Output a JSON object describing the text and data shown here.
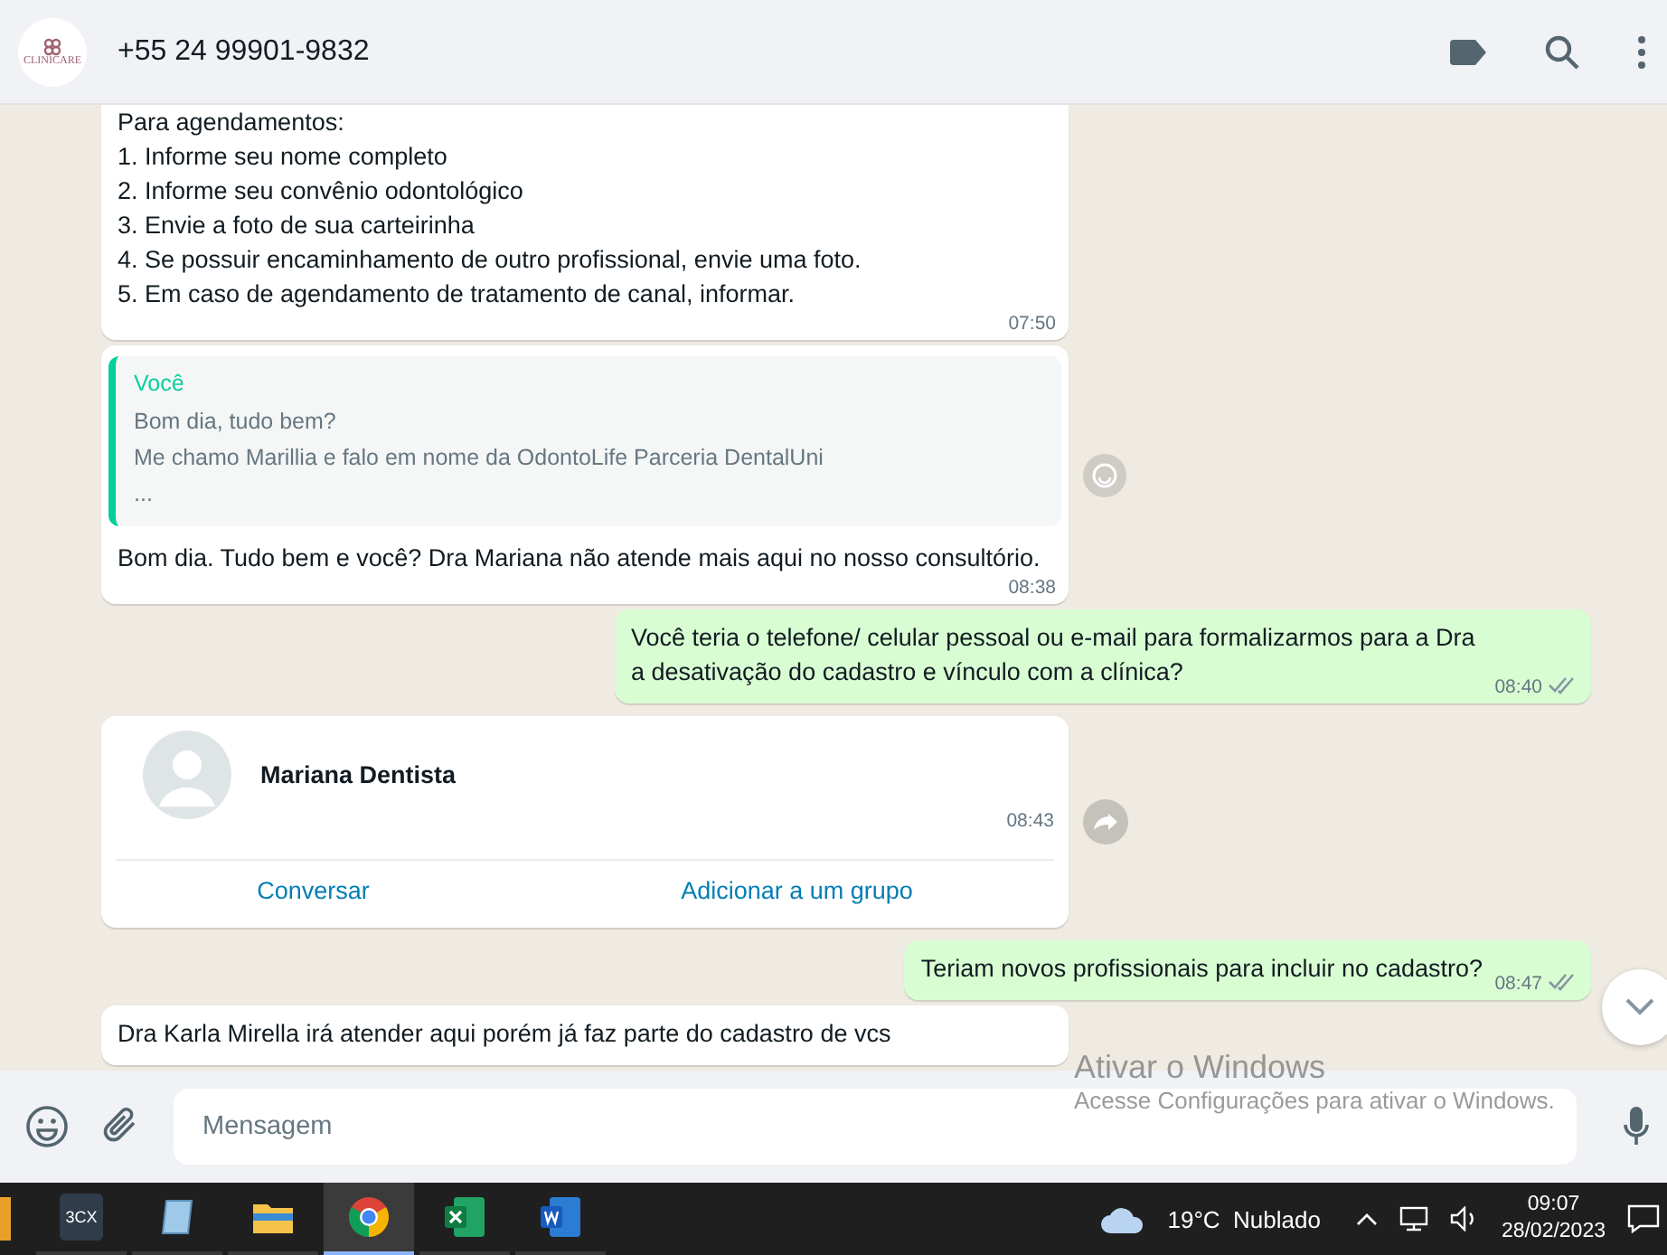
{
  "header": {
    "logo_text": "CLINICARE",
    "title": "+55 24 99901-9832"
  },
  "messages": [
    {
      "kind": "in",
      "lines": [
        "Para agendamentos:",
        "1. Informe seu nome completo",
        "2. Informe seu convênio odontológico",
        "3. Envie a foto de sua carteirinha",
        "4. Se possuir encaminhamento de outro profissional, envie uma foto.",
        "5. Em caso de agendamento de tratamento de canal, informar."
      ],
      "time": "07:50"
    },
    {
      "kind": "in_quote",
      "quote_author": "Você",
      "quote_lines": [
        "Bom dia, tudo bem?",
        "Me chamo Marillia e falo em nome da OdontoLife Parceria DentalUni",
        "..."
      ],
      "lines": [
        "Bom dia. Tudo bem e você? Dra Mariana  não atende mais aqui no nosso consultório."
      ],
      "time": "08:38"
    },
    {
      "kind": "out",
      "lines": [
        "Você teria o telefone/ celular pessoal ou e-mail para formalizarmos para a Dra a desativação do cadastro e vínculo com a clínica?"
      ],
      "time": "08:40"
    },
    {
      "kind": "contact",
      "name": "Mariana Dentista",
      "time": "08:43",
      "actions": [
        "Conversar",
        "Adicionar a um grupo"
      ]
    },
    {
      "kind": "out",
      "lines": [
        "Teriam novos profissionais para incluir no cadastro?"
      ],
      "time": "08:47"
    },
    {
      "kind": "in",
      "lines": [
        "Dra Karla Mirella irá atender aqui porém já faz parte do cadastro de vcs"
      ]
    }
  ],
  "composer": {
    "placeholder": "Mensagem"
  },
  "activation": {
    "title": "Ativar o Windows",
    "subtitle": "Acesse Configurações para ativar o Windows."
  },
  "taskbar": {
    "apps": [
      {
        "kind": "phone",
        "label": "3CX",
        "selected": false
      },
      {
        "kind": "notes",
        "selected": false
      },
      {
        "kind": "folder",
        "selected": false
      },
      {
        "kind": "chrome",
        "selected": true
      },
      {
        "kind": "excel",
        "selected": false
      },
      {
        "kind": "word",
        "selected": false
      }
    ],
    "weather": "19°C  Nublado",
    "time": "09:07",
    "date": "28/02/2023"
  }
}
